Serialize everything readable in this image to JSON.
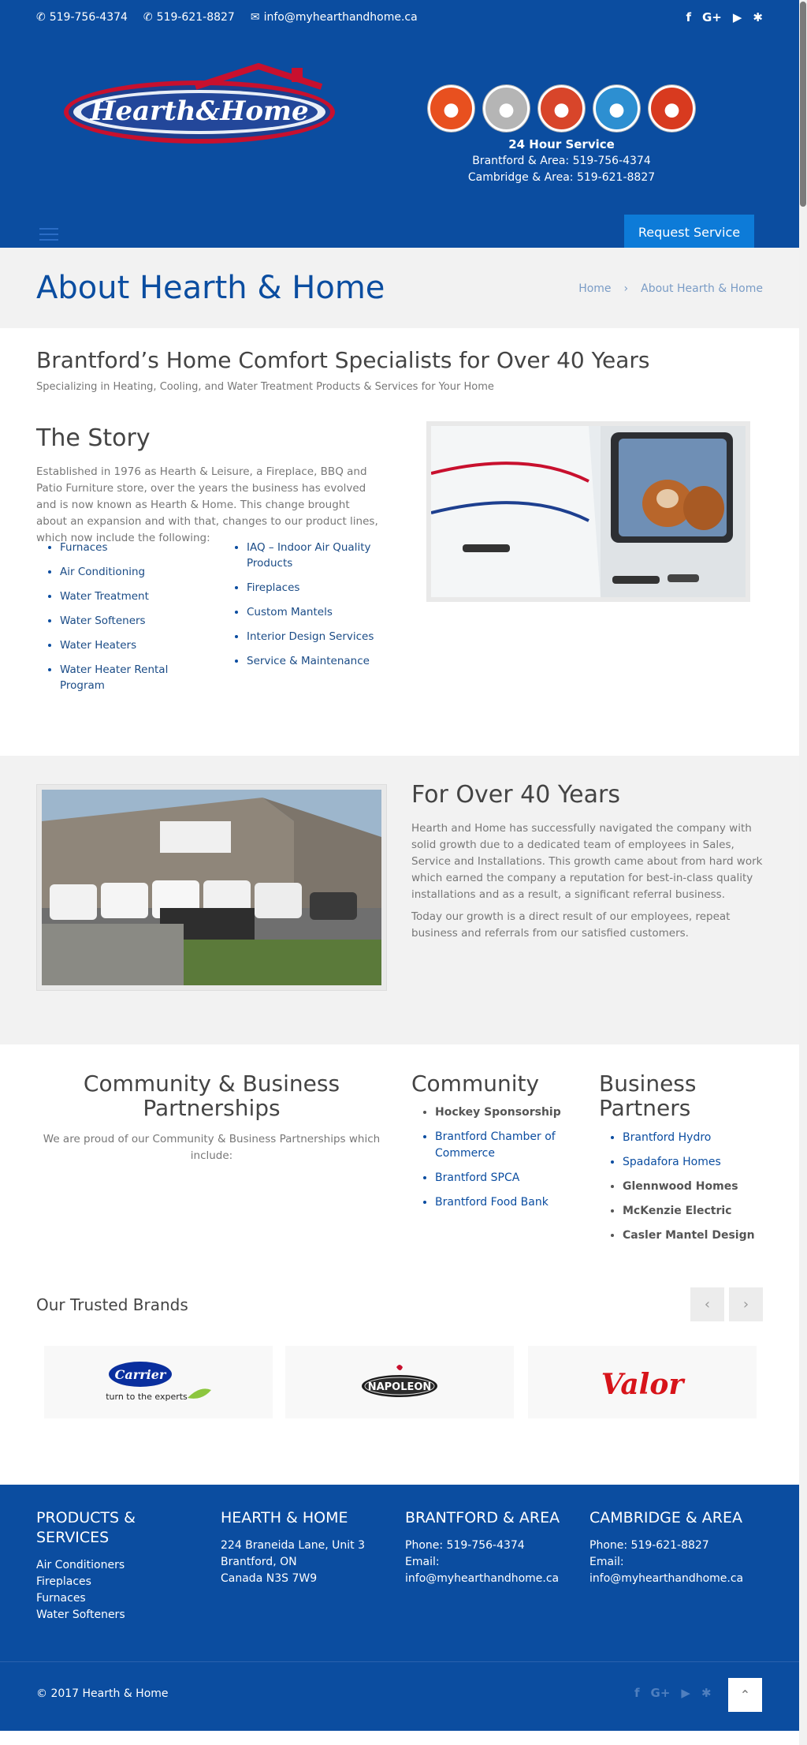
{
  "topbar": {
    "phone1": "519-756-4374",
    "phone2": "519-621-8827",
    "email": "info@myhearthandhome.ca",
    "social": [
      "f",
      "G+",
      "▶",
      "✱"
    ]
  },
  "header": {
    "logo_text": "Hearth&Home",
    "service_title": "24 Hour Service",
    "brantford_line": "Brantford & Area: 519-756-4374",
    "cambridge_line": "Cambridge & Area: 519-621-8827",
    "request_button": "Request Service",
    "icon_colors": [
      "#e8501f",
      "#b5b5b5",
      "#d8452a",
      "#2d8fd1",
      "#d83a1f"
    ]
  },
  "titlebar": {
    "title": "About Hearth & Home",
    "breadcrumb_home": "Home",
    "breadcrumb_sep": "›",
    "breadcrumb_current": "About Hearth & Home"
  },
  "intro": {
    "heading": "Brantford’s Home Comfort Specialists for Over 40 Years",
    "subheading": "Specializing in Heating, Cooling, and Water Treatment Products & Services for Your Home"
  },
  "story": {
    "heading": "The Story",
    "text": "Established in 1976 as Hearth & Leisure, a Fireplace, BBQ and Patio Furniture store, over the years the business has evolved and is now known as Hearth & Home. This change brought about an expansion and with that, changes to our product lines, which now include the following:",
    "list1": [
      "Furnaces",
      "Air Conditioning",
      "Water Treatment",
      "Water Softeners",
      "Water Heaters",
      "Water Heater Rental Program"
    ],
    "list2": [
      "IAQ – Indoor Air Quality Products",
      "Fireplaces",
      "Custom Mantels",
      "Interior Design Services",
      "Service & Maintenance"
    ]
  },
  "over": {
    "heading": "For Over 40 Years",
    "p1": "Hearth and Home has successfully navigated the company with solid growth due to a dedicated team of employees in Sales, Service and Installations. This growth came about from hard work which earned the company a reputation for best-in-class quality installations and as a result, a significant referral business.",
    "p2": "Today our growth is a direct result of our employees, repeat business and referrals from our satisfied customers."
  },
  "community": {
    "heading": "Community & Business Partnerships",
    "text": "We are proud of our Community & Business Partnerships which include:",
    "col2_heading": "Community",
    "col2_items": [
      "Hockey Sponsorship",
      "Brantford Chamber of Commerce",
      "Brantford SPCA",
      "Brantford Food Bank"
    ],
    "col3_heading": "Business Partners",
    "col3_items": [
      "Brantford Hydro",
      "Spadafora Homes",
      "Glennwood Homes",
      "McKenzie Electric",
      "Casler Mantel Design"
    ]
  },
  "brands": {
    "heading": "Our Trusted Brands",
    "prev": "‹",
    "next": "›",
    "carrier": "Carrier",
    "carrier_tag": "turn to the experts",
    "napoleon": "NAPOLEON",
    "valor": "Valor"
  },
  "footer": {
    "col1_heading": "PRODUCTS & SERVICES",
    "col1_items": [
      "Air Conditioners",
      "Fireplaces",
      "Furnaces",
      "Water Softeners"
    ],
    "col2_heading": "HEARTH & HOME",
    "col2_lines": [
      "224 Braneida Lane, Unit 3",
      "Brantford, ON",
      "Canada N3S 7W9"
    ],
    "col3_heading": "BRANTFORD & AREA",
    "col3_lines": [
      "Phone: 519-756-4374",
      "Email:",
      "info@myhearthandhome.ca"
    ],
    "col4_heading": "CAMBRIDGE & AREA",
    "col4_lines": [
      "Phone: 519-621-8827",
      "Email:",
      "info@myhearthandhome.ca"
    ],
    "copyright": "© 2017 Hearth & Home",
    "back_to_top": "⌃"
  }
}
